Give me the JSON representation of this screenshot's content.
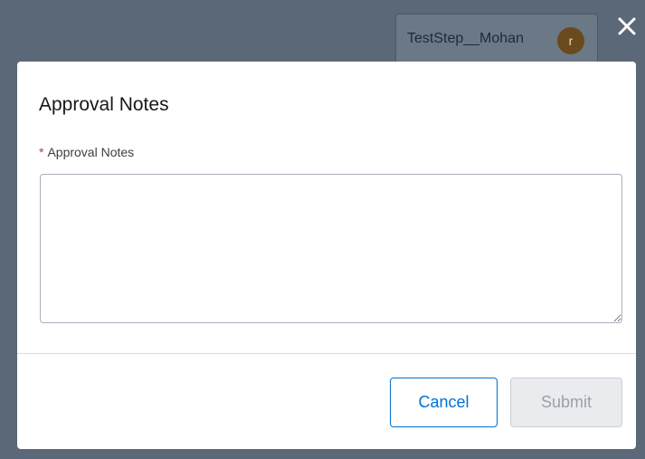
{
  "background": {
    "user_chip": {
      "label": "TestStep__Mohan",
      "avatar_initial": "r"
    }
  },
  "modal": {
    "title": "Approval Notes",
    "field": {
      "required_marker": "*",
      "label": "Approval Notes",
      "value": "",
      "placeholder": ""
    },
    "buttons": {
      "cancel_label": "Cancel",
      "submit_label": "Submit"
    }
  },
  "colors": {
    "overlay": "#5b6877",
    "brand_blue": "#0070d2",
    "required_red": "#c23934",
    "disabled_bg": "#e9ebee"
  },
  "icons": {
    "close": "close-icon",
    "resize": "resize-handle-icon"
  }
}
